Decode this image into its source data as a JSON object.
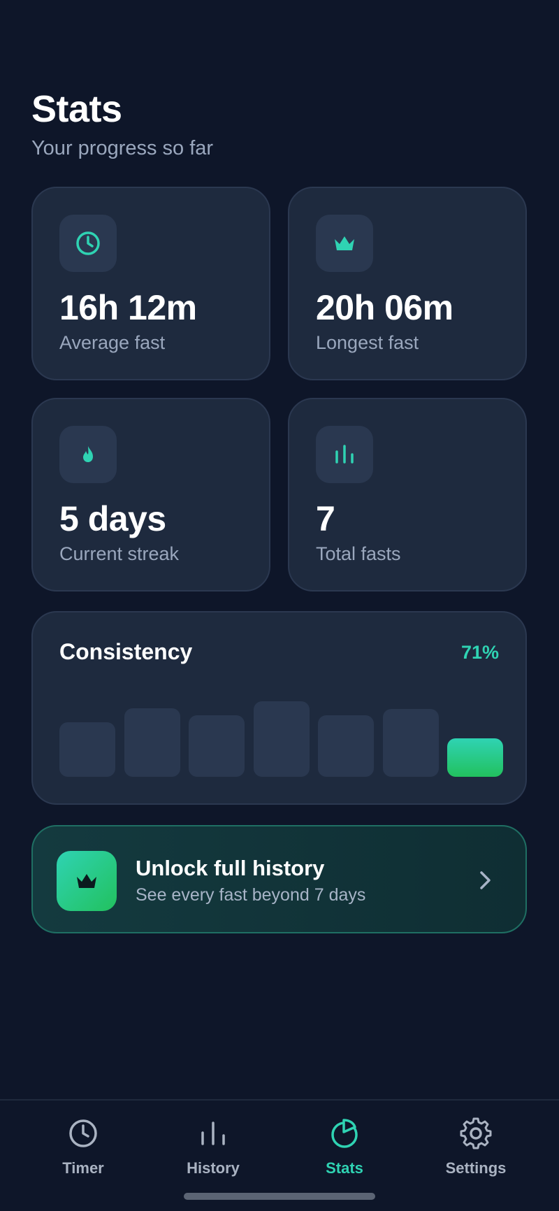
{
  "header": {
    "title": "Stats",
    "subtitle": "Your progress so far"
  },
  "stats": [
    {
      "icon": "clock-icon",
      "value": "16h 12m",
      "label": "Average fast"
    },
    {
      "icon": "crown-icon",
      "value": "20h 06m",
      "label": "Longest fast"
    },
    {
      "icon": "flame-icon",
      "value": "5 days",
      "label": "Current streak"
    },
    {
      "icon": "bar-chart-icon",
      "value": "7",
      "label": "Total fasts"
    }
  ],
  "consistency": {
    "title": "Consistency",
    "percent": "71%",
    "bars": [
      0.65,
      0.82,
      0.73,
      0.9,
      0.73,
      0.81,
      0.46
    ],
    "highlight_index": 6
  },
  "promo": {
    "title": "Unlock full history",
    "subtitle": "See every fast beyond 7 days"
  },
  "tabs": [
    {
      "label": "Timer",
      "icon": "clock-icon",
      "active": false
    },
    {
      "label": "History",
      "icon": "bar-chart-icon",
      "active": false
    },
    {
      "label": "Stats",
      "icon": "pie-chart-icon",
      "active": true
    },
    {
      "label": "Settings",
      "icon": "gear-icon",
      "active": false
    }
  ],
  "colors": {
    "background": "#0e1629",
    "card": "#1e2a3e",
    "accent": "#2fd3b3",
    "accent_green": "#22c15e",
    "muted_text": "#9aa7bd"
  }
}
